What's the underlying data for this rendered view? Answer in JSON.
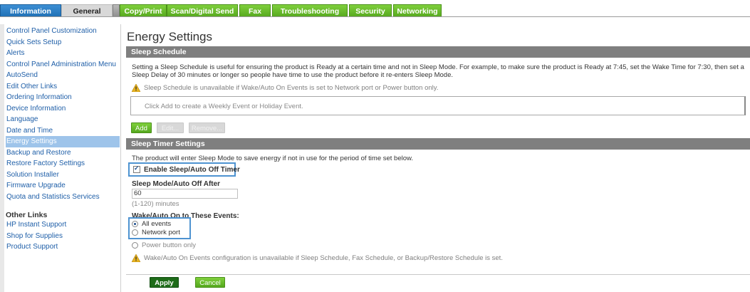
{
  "tabs": [
    {
      "label": "Information"
    },
    {
      "label": "General"
    },
    {
      "label": "Copy/Print"
    },
    {
      "label": "Scan/Digital Send"
    },
    {
      "label": "Fax"
    },
    {
      "label": "Troubleshooting"
    },
    {
      "label": "Security"
    },
    {
      "label": "Networking"
    }
  ],
  "active_tab": "General",
  "sidebar": {
    "items": [
      {
        "label": "Control Panel Customization"
      },
      {
        "label": "Quick Sets Setup"
      },
      {
        "label": "Alerts"
      },
      {
        "label": "Control Panel Administration Menu"
      },
      {
        "label": "AutoSend"
      },
      {
        "label": "Edit Other Links"
      },
      {
        "label": "Ordering Information"
      },
      {
        "label": "Device Information"
      },
      {
        "label": "Language"
      },
      {
        "label": "Date and Time"
      },
      {
        "label": "Energy Settings"
      },
      {
        "label": "Backup and Restore"
      },
      {
        "label": "Restore Factory Settings"
      },
      {
        "label": "Solution Installer"
      },
      {
        "label": "Firmware Upgrade"
      },
      {
        "label": "Quota and Statistics Services"
      }
    ],
    "selected": "Energy Settings",
    "other_links_title": "Other Links",
    "other_links": [
      {
        "label": "HP Instant Support"
      },
      {
        "label": "Shop for Supplies"
      },
      {
        "label": "Product Support"
      }
    ]
  },
  "page": {
    "title": "Energy Settings",
    "sleep_schedule": {
      "header": "Sleep Schedule",
      "description": "Setting a Sleep Schedule is useful for ensuring the product is Ready at a certain time and not in Sleep Mode. For example, to make sure the product is Ready at 7:45, set the Wake Time for 7:30, then set a Sleep Delay of 30 minutes or longer so people have time to use the product before it re-enters Sleep Mode.",
      "warning": "Sleep Schedule is unavailable if Wake/Auto On Events is set to Network port or Power button only.",
      "event_box_text": "Click Add to create a Weekly Event or Holiday Event.",
      "add_button": "Add",
      "edit_button": "Edit...",
      "remove_button": "Remove..."
    },
    "sleep_timer": {
      "header": "Sleep Timer Settings",
      "description": "The product will enter Sleep Mode to save energy if not in use for the period of time set below.",
      "enable_label": "Enable Sleep/Auto Off Timer",
      "enable_checked": true,
      "auto_off_label": "Sleep Mode/Auto Off After",
      "auto_off_value": "60",
      "auto_off_hint": "(1-120) minutes",
      "wake_label": "Wake/Auto On to These Events:",
      "wake_options": [
        {
          "label": "All events",
          "checked": true
        },
        {
          "label": "Network port",
          "checked": false
        },
        {
          "label": "Power button only",
          "checked": false
        }
      ],
      "warning": "Wake/Auto On Events configuration is unavailable if Sleep Schedule, Fax Schedule, or Backup/Restore Schedule is set."
    },
    "apply_button": "Apply",
    "cancel_button": "Cancel"
  },
  "colors": {
    "tab_green": "#6abf2d",
    "tab_blue": "#2a7cc4",
    "section_header": "#7f7f7f",
    "nav_link": "#1f5fa8",
    "nav_selected": "#9ec4ea",
    "highlight_box": "#4e93d1",
    "warning_icon": "#e8b422"
  }
}
